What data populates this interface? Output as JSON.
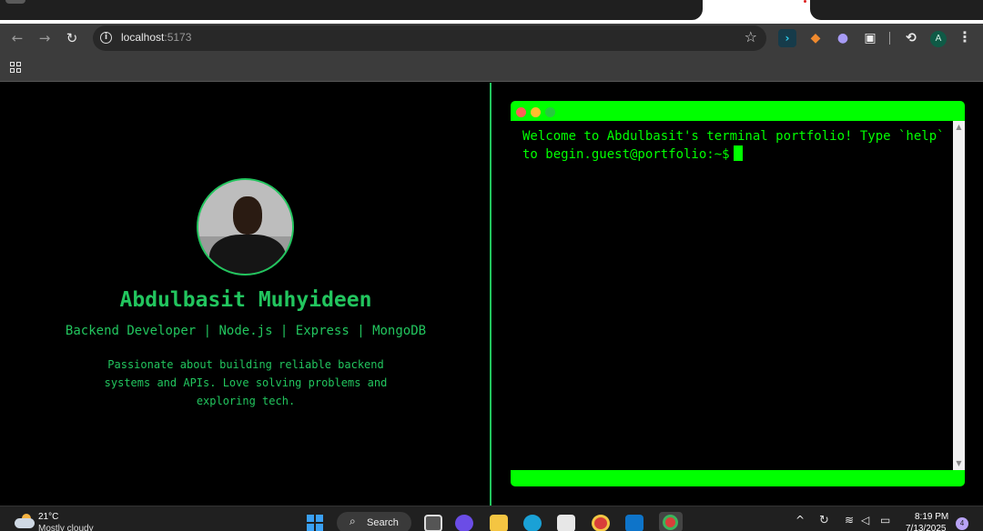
{
  "browser": {
    "url_host": "localhost",
    "url_port": ":5173",
    "profile_initial": "A",
    "icons": {
      "back": "arrow-left-icon",
      "forward": "arrow-right-icon",
      "reload": "reload-icon",
      "site_info": "info-icon",
      "bookmark": "star-icon",
      "menu": "kebab-menu-icon",
      "apps": "apps-grid-icon"
    }
  },
  "profile": {
    "name": "Abdulbasit Muhyideen",
    "subtitle": "Backend Developer | Node.js | Express | MongoDB",
    "bio": "Passionate about building reliable backend systems and APIs. Love solving problems and exploring tech."
  },
  "terminal": {
    "output": "Welcome to Abdulbasit's terminal portfolio! Type `help` to begin.guest@portfolio:~$",
    "colors": {
      "accent": "#00ff00",
      "dot_red": "#ff5f56",
      "dot_yellow": "#ffbd2e",
      "dot_green": "#27c93f"
    }
  },
  "taskbar": {
    "temperature": "21°C",
    "weather": "Mostly cloudy",
    "search_label": "Search",
    "time": "8:19 PM",
    "date": "7/13/2025",
    "notifications": "4"
  },
  "colors": {
    "brand_green": "#22c55e",
    "page_background": "#000000",
    "chrome_toolbar": "#3c3c3c"
  }
}
